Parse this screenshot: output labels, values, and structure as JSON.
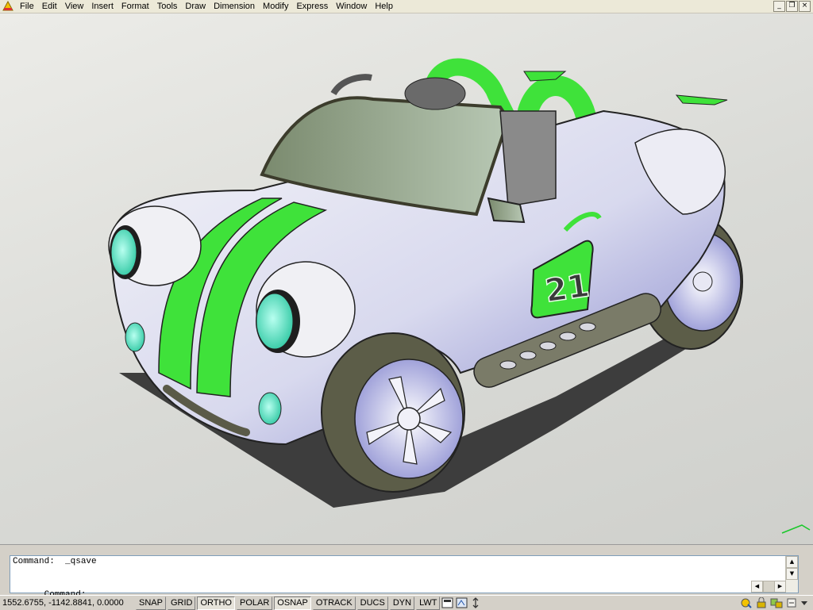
{
  "menu": {
    "items": [
      "File",
      "Edit",
      "View",
      "Insert",
      "Format",
      "Tools",
      "Draw",
      "Dimension",
      "Modify",
      "Express",
      "Window",
      "Help"
    ],
    "window_controls": {
      "minimize": "_",
      "restore": "❐",
      "close": "×"
    }
  },
  "viewport": {
    "car_number": "21"
  },
  "command": {
    "history": "Command:  _qsave",
    "prompt": "Command: ",
    "input_value": ""
  },
  "status": {
    "coordinates": "1552.6755, -1142.8841, 0.0000",
    "toggles": [
      {
        "label": "SNAP",
        "on": false
      },
      {
        "label": "GRID",
        "on": false
      },
      {
        "label": "ORTHO",
        "on": true
      },
      {
        "label": "POLAR",
        "on": false
      },
      {
        "label": "OSNAP",
        "on": true
      },
      {
        "label": "OTRACK",
        "on": false
      },
      {
        "label": "DUCS",
        "on": false
      },
      {
        "label": "DYN",
        "on": false
      },
      {
        "label": "LWT",
        "on": false
      }
    ],
    "icons": [
      "model-icon",
      "maximize-viewport-icon",
      "sync-icon"
    ],
    "tray_icons": [
      "communication-center-icon",
      "lock-icon",
      "toolbar-lock-icon",
      "settings-icon",
      "clean-screen-icon"
    ]
  },
  "colors": {
    "accent_green": "#3fe23a",
    "body": "#e8e8f2",
    "body_shadow": "#7d7fc8"
  }
}
